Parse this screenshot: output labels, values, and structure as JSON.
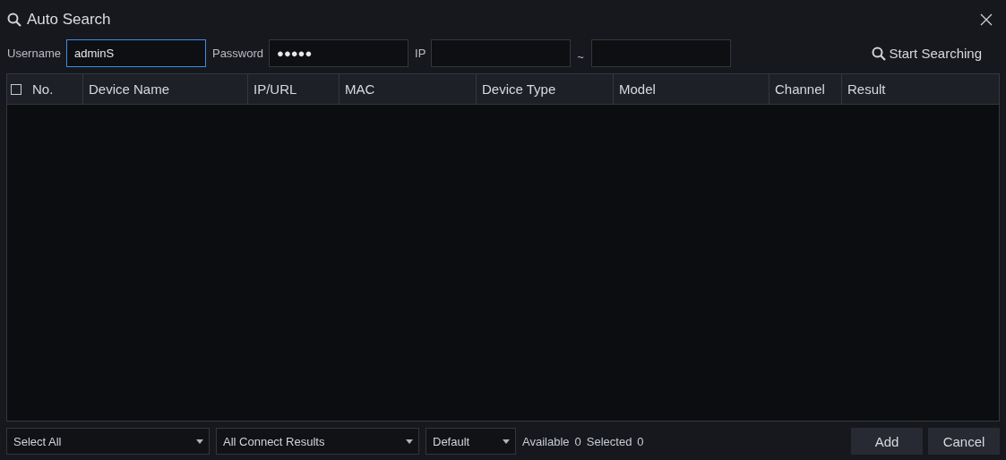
{
  "window": {
    "title": "Auto Search"
  },
  "form": {
    "username": {
      "label": "Username",
      "value": "adminS",
      "focused": true
    },
    "password": {
      "label": "Password",
      "value": "●●●●●",
      "focused": false
    },
    "ip": {
      "label": "IP",
      "separator": "~"
    },
    "search_button": "Start Searching"
  },
  "table": {
    "select_all_checked": false,
    "columns": [
      "No.",
      "Device Name",
      "IP/URL",
      "MAC",
      "Device Type",
      "Model",
      "Channel",
      "Result"
    ]
  },
  "footer": {
    "dropdowns": [
      "Select All",
      "All Connect Results",
      "Default"
    ],
    "available_label": "Available",
    "available": "0",
    "selected_label": "Selected",
    "selected": "0",
    "buttons": [
      "Add",
      "Cancel"
    ]
  }
}
